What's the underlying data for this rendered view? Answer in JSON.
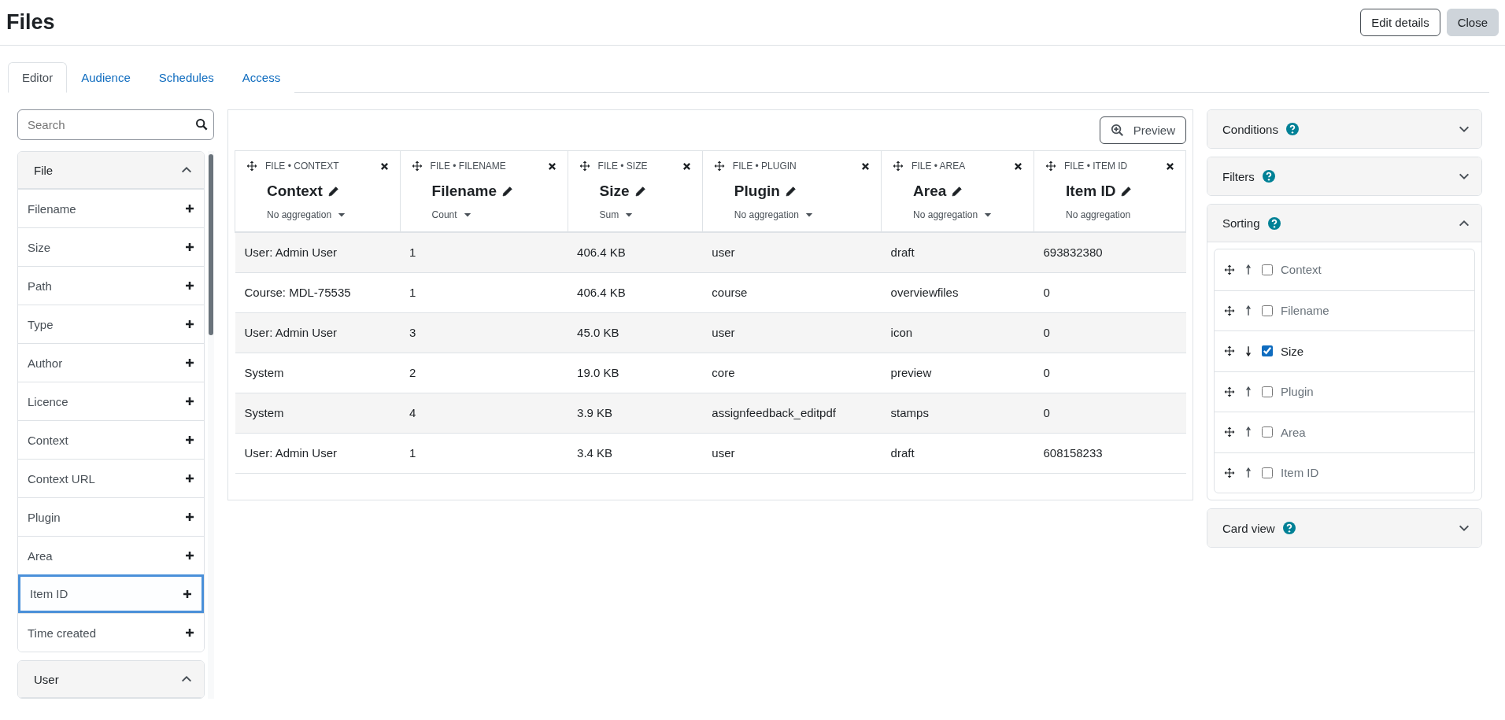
{
  "page": {
    "title": "Files",
    "buttons": [
      {
        "label": "Edit details",
        "kind": "outline"
      },
      {
        "label": "Close",
        "kind": "secondary"
      }
    ]
  },
  "tabs": [
    {
      "label": "Editor",
      "selected": true
    },
    {
      "label": "Audience",
      "selected": false
    },
    {
      "label": "Schedules",
      "selected": false
    },
    {
      "label": "Access",
      "selected": false
    }
  ],
  "sidebar": {
    "search": {
      "placeholder": "Search"
    },
    "groups": [
      {
        "title": "File",
        "expanded": true,
        "items": [
          {
            "label": "Filename",
            "focused": false
          },
          {
            "label": "Size",
            "focused": false
          },
          {
            "label": "Path",
            "focused": false
          },
          {
            "label": "Type",
            "focused": false
          },
          {
            "label": "Author",
            "focused": false
          },
          {
            "label": "Licence",
            "focused": false
          },
          {
            "label": "Context",
            "focused": false
          },
          {
            "label": "Context URL",
            "focused": false
          },
          {
            "label": "Plugin",
            "focused": false
          },
          {
            "label": "Area",
            "focused": false
          },
          {
            "label": "Item ID",
            "focused": true
          },
          {
            "label": "Time created",
            "focused": false
          }
        ]
      },
      {
        "title": "User",
        "expanded": true
      }
    ]
  },
  "report": {
    "preview_button": "Preview",
    "columns": [
      {
        "source": "FILE • CONTEXT",
        "title": "Context",
        "aggregation": "No aggregation",
        "has_menu": true
      },
      {
        "source": "FILE • FILENAME",
        "title": "Filename",
        "aggregation": "Count",
        "has_menu": true
      },
      {
        "source": "FILE • SIZE",
        "title": "Size",
        "aggregation": "Sum",
        "has_menu": true
      },
      {
        "source": "FILE • PLUGIN",
        "title": "Plugin",
        "aggregation": "No aggregation",
        "has_menu": true
      },
      {
        "source": "FILE • AREA",
        "title": "Area",
        "aggregation": "No aggregation",
        "has_menu": true
      },
      {
        "source": "FILE • ITEM ID",
        "title": "Item ID",
        "aggregation": "No aggregation",
        "has_menu": false
      }
    ],
    "rows": [
      [
        "User: Admin User",
        "1",
        "406.4 KB",
        "user",
        "draft",
        "693832380"
      ],
      [
        "Course: MDL-75535",
        "1",
        "406.4 KB",
        "course",
        "overviewfiles",
        "0"
      ],
      [
        "User: Admin User",
        "3",
        "45.0 KB",
        "user",
        "icon",
        "0"
      ],
      [
        "System",
        "2",
        "19.0 KB",
        "core",
        "preview",
        "0"
      ],
      [
        "System",
        "4",
        "3.9 KB",
        "assignfeedback_editpdf",
        "stamps",
        "0"
      ],
      [
        "User: Admin User",
        "1",
        "3.4 KB",
        "user",
        "draft",
        "608158233"
      ]
    ]
  },
  "settings": [
    {
      "title": "Conditions",
      "expanded": false
    },
    {
      "title": "Filters",
      "expanded": false
    },
    {
      "title": "Sorting",
      "expanded": true,
      "items": [
        {
          "label": "Context",
          "descending": false,
          "checked": false
        },
        {
          "label": "Filename",
          "descending": false,
          "checked": false
        },
        {
          "label": "Size",
          "descending": true,
          "checked": true
        },
        {
          "label": "Plugin",
          "descending": false,
          "checked": false
        },
        {
          "label": "Area",
          "descending": false,
          "checked": false
        },
        {
          "label": "Item ID",
          "descending": false,
          "checked": false
        }
      ]
    },
    {
      "title": "Card view",
      "expanded": false
    }
  ]
}
